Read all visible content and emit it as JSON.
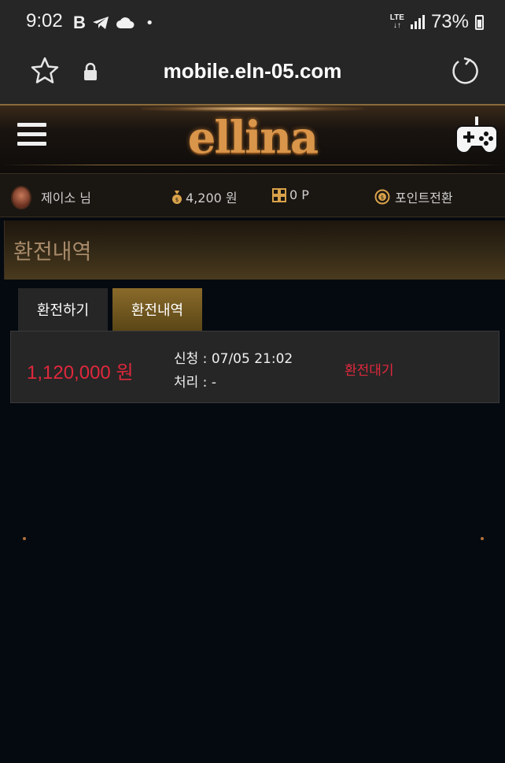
{
  "status_bar": {
    "time": "9:02",
    "network": "LTE",
    "battery": "73%"
  },
  "browser": {
    "url": "mobile.eln-05.com"
  },
  "site": {
    "logo_text": "ellina"
  },
  "user": {
    "name": "제이소 님",
    "money": "4,200 원",
    "points": "0 P",
    "convert_label": "포인트전환"
  },
  "page": {
    "title": "환전내역"
  },
  "tabs": [
    {
      "label": "환전하기",
      "active": false
    },
    {
      "label": "환전내역",
      "active": true
    }
  ],
  "history": [
    {
      "amount": "1,120,000 원",
      "requested": "신청 : 07/05 21:02",
      "processed": "처리 : -",
      "status": "환전대기"
    }
  ],
  "colors": {
    "accent_gold": "#8a6a2a",
    "amount_red": "#e0283c",
    "background": "#050a10"
  }
}
